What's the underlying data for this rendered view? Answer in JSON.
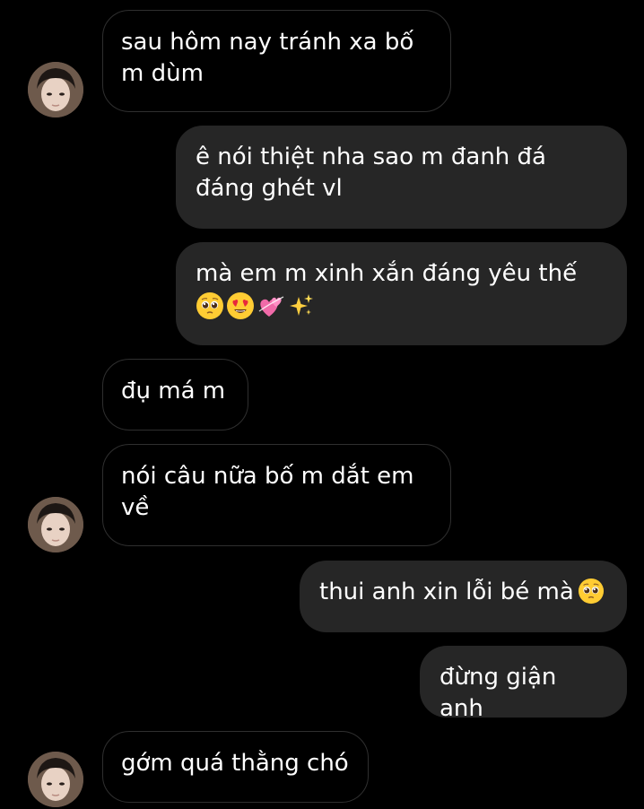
{
  "conversation": {
    "messages": [
      {
        "sender": "them",
        "text": "sau hôm nay tránh xa bố m dùm",
        "avatar": true
      },
      {
        "sender": "me",
        "text": "ê nói thiệt nha sao m đanh đá đáng ghét vl"
      },
      {
        "sender": "me",
        "text": "mà em m xinh xắn đáng yêu thế",
        "emojis": [
          "pleading-face-icon",
          "heart-eyes-icon",
          "revolving-hearts-icon",
          "sparkles-icon"
        ]
      },
      {
        "sender": "them",
        "text": "đụ má m",
        "avatar": false
      },
      {
        "sender": "them",
        "text": "nói câu nữa bố m dắt em về",
        "avatar": true
      },
      {
        "sender": "me",
        "text": "thui anh xin lỗi bé mà",
        "emojis": [
          "pleading-face-icon"
        ]
      },
      {
        "sender": "me",
        "text": "đừng giận anh"
      },
      {
        "sender": "them",
        "text": "gớm quá thằng chó",
        "avatar": true
      }
    ]
  },
  "colors": {
    "background": "#000000",
    "outgoing_bubble": "#262626",
    "incoming_border": "#2f2f2f",
    "text": "#ffffff"
  }
}
